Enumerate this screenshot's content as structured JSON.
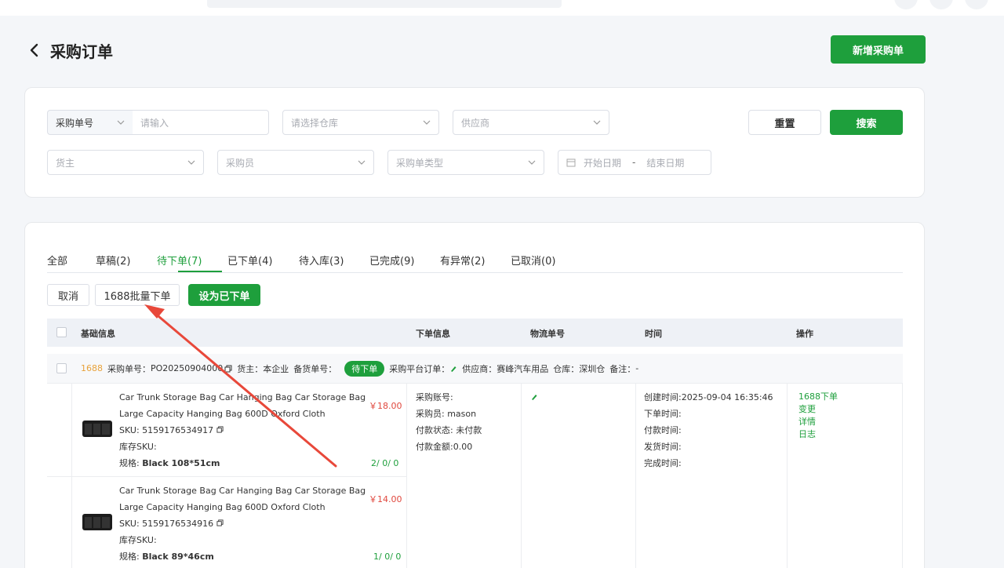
{
  "header": {
    "title": "采购订单",
    "new_button": "新增采购单"
  },
  "filters": {
    "order_no_select": "采购单号",
    "order_no_placeholder": "请输入",
    "warehouse_placeholder": "请选择仓库",
    "supplier_placeholder": "供应商",
    "owner_placeholder": "货主",
    "buyer_placeholder": "采购员",
    "order_type_placeholder": "采购单类型",
    "start_date_placeholder": "开始日期",
    "date_separator": "-",
    "end_date_placeholder": "结束日期",
    "reset_button": "重置",
    "search_button": "搜索"
  },
  "tabs": [
    {
      "label": "全部"
    },
    {
      "label": "草稿(2)"
    },
    {
      "label": "待下单(7)"
    },
    {
      "label": "已下单(4)"
    },
    {
      "label": "待入库(3)"
    },
    {
      "label": "已完成(9)"
    },
    {
      "label": "有异常(2)"
    },
    {
      "label": "已取消(0)"
    }
  ],
  "active_tab": "待下单(7)",
  "actions": {
    "cancel": "取消",
    "batch_order": "1688批量下单",
    "set_ordered": "设为已下单"
  },
  "table_headers": {
    "basic": "基础信息",
    "order_info": "下单信息",
    "logistics": "物流单号",
    "time": "时间",
    "ops": "操作"
  },
  "order": {
    "source": "1688",
    "po_label": "采购单号：",
    "po_number": "PO20250904000",
    "owner_label": "货主：",
    "owner": "本企业",
    "stock_no_label": "备货单号：",
    "status": "待下单",
    "platform_order_label": "采购平台订单：",
    "supplier_label": "供应商：",
    "supplier": "赛峰汽车用品",
    "warehouse_label": "仓库：",
    "warehouse": "深圳仓",
    "remark_label": "备注：",
    "remark": "-",
    "items": [
      {
        "title_line1": "Car Trunk Storage Bag Car Hanging Bag Car Storage Bag",
        "title_line2": "Large Capacity Hanging Bag 600D Oxford Cloth",
        "sku": "SKU: 5159176534917",
        "stock_sku": "库存SKU:",
        "spec_label": "规格:",
        "spec": "Black 108*51cm",
        "price": "￥18.00",
        "qty": "2/ 0/ 0"
      },
      {
        "title_line1": "Car Trunk Storage Bag Car Hanging Bag Car Storage Bag",
        "title_line2": "Large Capacity Hanging Bag 600D Oxford Cloth",
        "sku": "SKU: 5159176534916",
        "stock_sku": "库存SKU:",
        "spec_label": "规格:",
        "spec": "Black 89*46cm",
        "price": "￥14.00",
        "qty": "1/ 0/ 0"
      }
    ],
    "order_info": {
      "account": "采购账号:",
      "buyer": "采购员: mason",
      "pay_status": "付款状态: 未付款",
      "pay_amount": "付款金额:0.00"
    },
    "times": {
      "created": "创建时间:2025-09-04 16:35:46",
      "ordered": "下单时间:",
      "paid": "付款时间:",
      "shipped": "发货时间:",
      "completed": "完成时间:"
    },
    "ops": [
      "1688下单",
      "变更",
      "详情",
      "日志"
    ]
  },
  "colors": {
    "primary": "#1e9f3c",
    "price": "#e0483e",
    "source": "#e8a23a",
    "annotation_arrow": "#e8483a"
  }
}
